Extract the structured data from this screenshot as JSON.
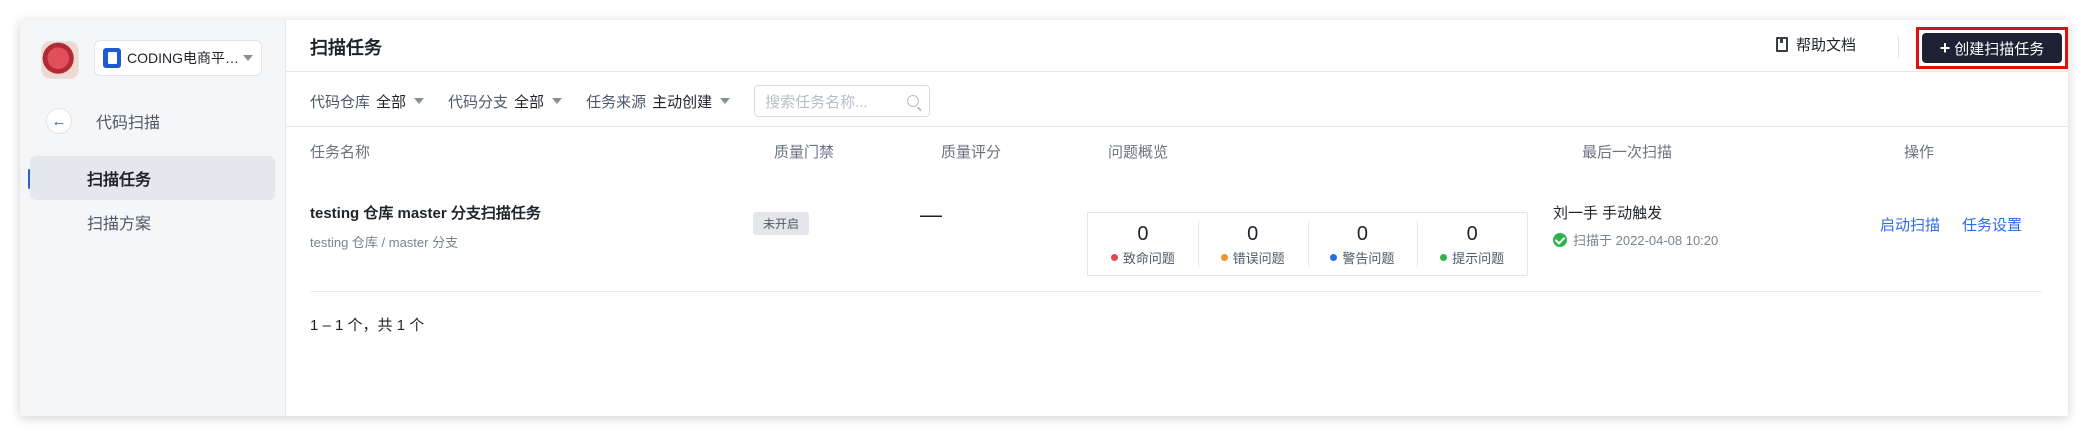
{
  "sidebar": {
    "project_name": "CODING电商平…",
    "back_label": "代码扫描",
    "items": [
      {
        "label": "扫描任务",
        "active": true
      },
      {
        "label": "扫描方案",
        "active": false
      }
    ]
  },
  "header": {
    "title": "扫描任务",
    "help_label": "帮助文档",
    "create_label": "创建扫描任务",
    "create_plus": "+"
  },
  "filters": {
    "repo": {
      "label": "代码仓库",
      "value": "全部"
    },
    "branch": {
      "label": "代码分支",
      "value": "全部"
    },
    "source": {
      "label": "任务来源",
      "value": "主动创建"
    },
    "search_placeholder": "搜索任务名称..."
  },
  "table": {
    "columns": [
      "任务名称",
      "质量门禁",
      "质量评分",
      "问题概览",
      "最后一次扫描",
      "操作"
    ],
    "rows": [
      {
        "name": "testing 仓库 master 分支扫描任务",
        "sub": "testing 仓库 / master 分支",
        "gate": "未开启",
        "score": "—",
        "issues": [
          {
            "count": "0",
            "label": "致命问题",
            "color": "#e5484d"
          },
          {
            "count": "0",
            "label": "错误问题",
            "color": "#f0932b"
          },
          {
            "count": "0",
            "label": "警告问题",
            "color": "#2b6be6"
          },
          {
            "count": "0",
            "label": "提示问题",
            "color": "#2fb24c"
          }
        ],
        "scan_user": "刘一手 手动触发",
        "scan_time": "扫描于 2022-04-08 10:20",
        "actions": [
          "启动扫描",
          "任务设置"
        ]
      }
    ]
  },
  "pagination": {
    "text": "1 – 1 个，共 1 个"
  },
  "colors": {
    "accent": "#2b6be6",
    "create_bg": "#1c2233",
    "highlight": "#e01010"
  }
}
